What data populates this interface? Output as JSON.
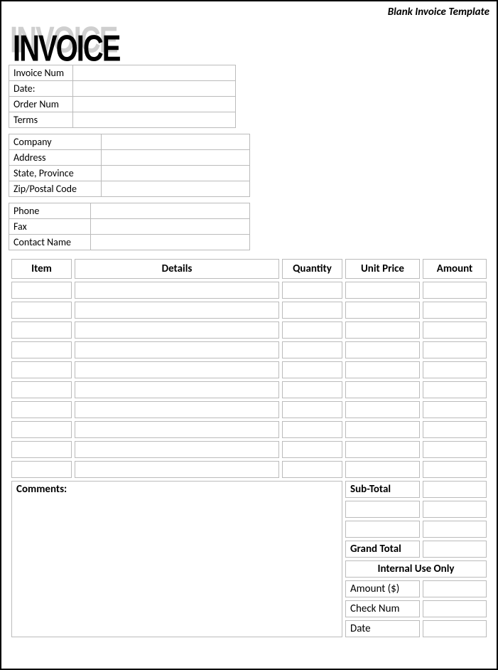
{
  "top_label": "Blank Invoice Template",
  "logo_text": "INVOICE",
  "block1": {
    "rows": [
      {
        "label": "Invoice Num",
        "value": ""
      },
      {
        "label": "Date:",
        "value": ""
      },
      {
        "label": "Order Num",
        "value": ""
      },
      {
        "label": "Terms",
        "value": ""
      }
    ]
  },
  "block2": {
    "rows": [
      {
        "label": "Company",
        "value": ""
      },
      {
        "label": "Address",
        "value": ""
      },
      {
        "label": "State, Province",
        "value": ""
      },
      {
        "label": "Zip/Postal Code",
        "value": ""
      }
    ]
  },
  "block3": {
    "rows": [
      {
        "label": "Phone",
        "value": ""
      },
      {
        "label": "Fax",
        "value": ""
      },
      {
        "label": "Contact Name",
        "value": ""
      }
    ]
  },
  "items": {
    "headers": {
      "item": "Item",
      "details": "Details",
      "quantity": "Quantity",
      "unit_price": "Unit Price",
      "amount": "Amount"
    },
    "rows": [
      {
        "item": "",
        "details": "",
        "qty": "",
        "price": "",
        "amount": ""
      },
      {
        "item": "",
        "details": "",
        "qty": "",
        "price": "",
        "amount": ""
      },
      {
        "item": "",
        "details": "",
        "qty": "",
        "price": "",
        "amount": ""
      },
      {
        "item": "",
        "details": "",
        "qty": "",
        "price": "",
        "amount": ""
      },
      {
        "item": "",
        "details": "",
        "qty": "",
        "price": "",
        "amount": ""
      },
      {
        "item": "",
        "details": "",
        "qty": "",
        "price": "",
        "amount": ""
      },
      {
        "item": "",
        "details": "",
        "qty": "",
        "price": "",
        "amount": ""
      },
      {
        "item": "",
        "details": "",
        "qty": "",
        "price": "",
        "amount": ""
      },
      {
        "item": "",
        "details": "",
        "qty": "",
        "price": "",
        "amount": ""
      },
      {
        "item": "",
        "details": "",
        "qty": "",
        "price": "",
        "amount": ""
      }
    ]
  },
  "comments_label": "Comments:",
  "totals": {
    "sub_total_label": "Sub-Total",
    "sub_total_value": "",
    "extra_rows": [
      {
        "label": "",
        "value": ""
      },
      {
        "label": "",
        "value": ""
      }
    ],
    "grand_total_label": "Grand Total",
    "grand_total_value": "",
    "internal_header": "Internal Use Only",
    "internal_rows": [
      {
        "label": "Amount ($)",
        "value": ""
      },
      {
        "label": "Check Num",
        "value": ""
      },
      {
        "label": "Date",
        "value": ""
      }
    ]
  }
}
